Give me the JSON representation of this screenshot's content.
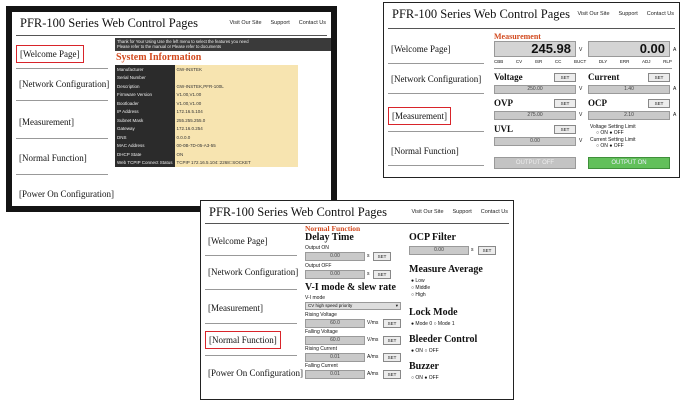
{
  "common": {
    "title": "PFR-100 Series Web Control Pages",
    "links": [
      "Visit Our Site",
      "Support",
      "Contact Us"
    ],
    "nav": [
      "[Welcome Page]",
      "[Network Configuration]",
      "[Measurement]",
      "[Normal Function]",
      "[Power On Configuration]"
    ]
  },
  "welcome": {
    "note_line1": "Thank for Your Using Use the left menu to select the features you need",
    "note_line2": "Please refer to the manual or Please refer to documents",
    "section": "System Information",
    "rows": [
      {
        "k": "Manufacturer",
        "v": "GW-INSTEK"
      },
      {
        "k": "Serial Number",
        "v": ""
      },
      {
        "k": "Description",
        "v": "GW-INSTEK,PFR-100L"
      },
      {
        "k": "Firmware Version",
        "v": "V1.00,V1.00"
      },
      {
        "k": "Bootloader",
        "v": "V1.00,V1.00"
      },
      {
        "k": "IP Address",
        "v": "172.16.5.104"
      },
      {
        "k": "Subnet Mask",
        "v": "255.255.255.0"
      },
      {
        "k": "Gateway",
        "v": "172.16.0.254"
      },
      {
        "k": "DNS",
        "v": "0.0.0.0"
      },
      {
        "k": "MAC Address",
        "v": "00-0B-7D-05-A3-55"
      },
      {
        "k": "DHCP State",
        "v": "ON"
      },
      {
        "k": "Web TCPIP Connect Status",
        "v": "TCPIP 172.16.5.104::2268::SOCKET"
      }
    ]
  },
  "measurement": {
    "section": "Measurement",
    "voltage_reading": "245.98",
    "voltage_unit": "V",
    "current_reading": "0.00",
    "current_unit": "A",
    "status_flags": [
      "CBB",
      "CV",
      "ISR",
      "CC",
      "BUCT",
      "DLY",
      "ERR",
      "ADJ",
      "RLP"
    ],
    "voltage_label": "Voltage",
    "voltage_set": "250.00",
    "current_label": "Current",
    "current_set": "1.40",
    "set_label": "SET",
    "ovp_label": "OVP",
    "ovp_set": "275.00",
    "ocp_label": "OCP",
    "ocp_set": "2.10",
    "uvl_label": "UVL",
    "uvl_set": "0.00",
    "vlock_label": "Voltage Setting Limit",
    "clock_label": "Current Setting Limit",
    "on_label": "ON",
    "off_label": "OFF",
    "output_off": "OUTPUT OFF",
    "output_on": "OUTPUT ON"
  },
  "normal": {
    "section": "Normal Function",
    "delay_title": "Delay Time",
    "output_on_lbl": "Output ON",
    "output_off_lbl": "Output OFF",
    "delay_on_val": "0.00",
    "delay_off_val": "0.00",
    "set_label": "SET",
    "vi_title": "V-I mode & slew rate",
    "vi_mode_lbl": "V-I mode",
    "vi_mode_val": "CV high speed priority",
    "rising_v_lbl": "Rising Voltage",
    "rising_v_val": "60.0",
    "falling_v_lbl": "Falling Voltage",
    "falling_v_val": "60.0",
    "rising_c_lbl": "Rising Current",
    "rising_c_val": "0.01",
    "falling_c_lbl": "Falling Current",
    "falling_c_val": "0.01",
    "ocp_filter_title": "OCP Filter",
    "ocp_filter_val": "0.00",
    "avg_title": "Measure Average",
    "avg_opts": [
      "Low",
      "Middle",
      "High"
    ],
    "lock_title": "Lock Mode",
    "lock_opts": [
      "Mode 0",
      "Mode 1"
    ],
    "bleeder_title": "Bleeder Control",
    "buzzer_title": "Buzzer",
    "on_label": "ON",
    "off_label": "OFF"
  }
}
